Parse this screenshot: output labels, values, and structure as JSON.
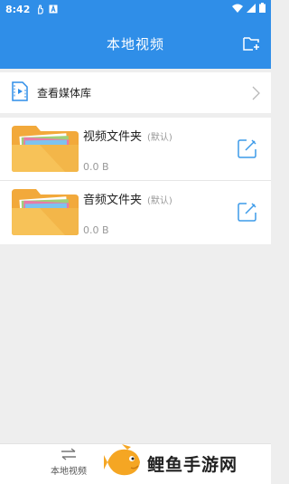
{
  "status_bar": {
    "time": "8:42",
    "icons": [
      "hand-icon",
      "a-box-icon"
    ],
    "right_icons": [
      "wifi-icon",
      "signal-icon",
      "battery-icon"
    ]
  },
  "app_bar": {
    "title": "本地视频",
    "action_icon": "new-folder-icon"
  },
  "media_row": {
    "label": "查看媒体库",
    "icon": "film-file-icon",
    "chevron_icon": "chevron-right-icon"
  },
  "folders": [
    {
      "name": "视频文件夹",
      "badge": "(默认)",
      "size": "0.0 B",
      "icon": "folder-icon",
      "edit_icon": "edit-icon"
    },
    {
      "name": "音频文件夹",
      "badge": "(默认)",
      "size": "0.0 B",
      "icon": "folder-icon",
      "edit_icon": "edit-icon"
    }
  ],
  "bottom_nav": {
    "tab_label": "本地视频",
    "tab_icon": "swap-arrows-icon"
  },
  "watermark": {
    "text": "鲤鱼手游网",
    "logo_icon": "fish-logo-icon"
  },
  "colors": {
    "primary": "#2f8ee8",
    "folder_yellow": "#f7c258",
    "folder_back": "#f2a93b",
    "edit_blue": "#3d9be9",
    "background": "#eeeeee"
  }
}
